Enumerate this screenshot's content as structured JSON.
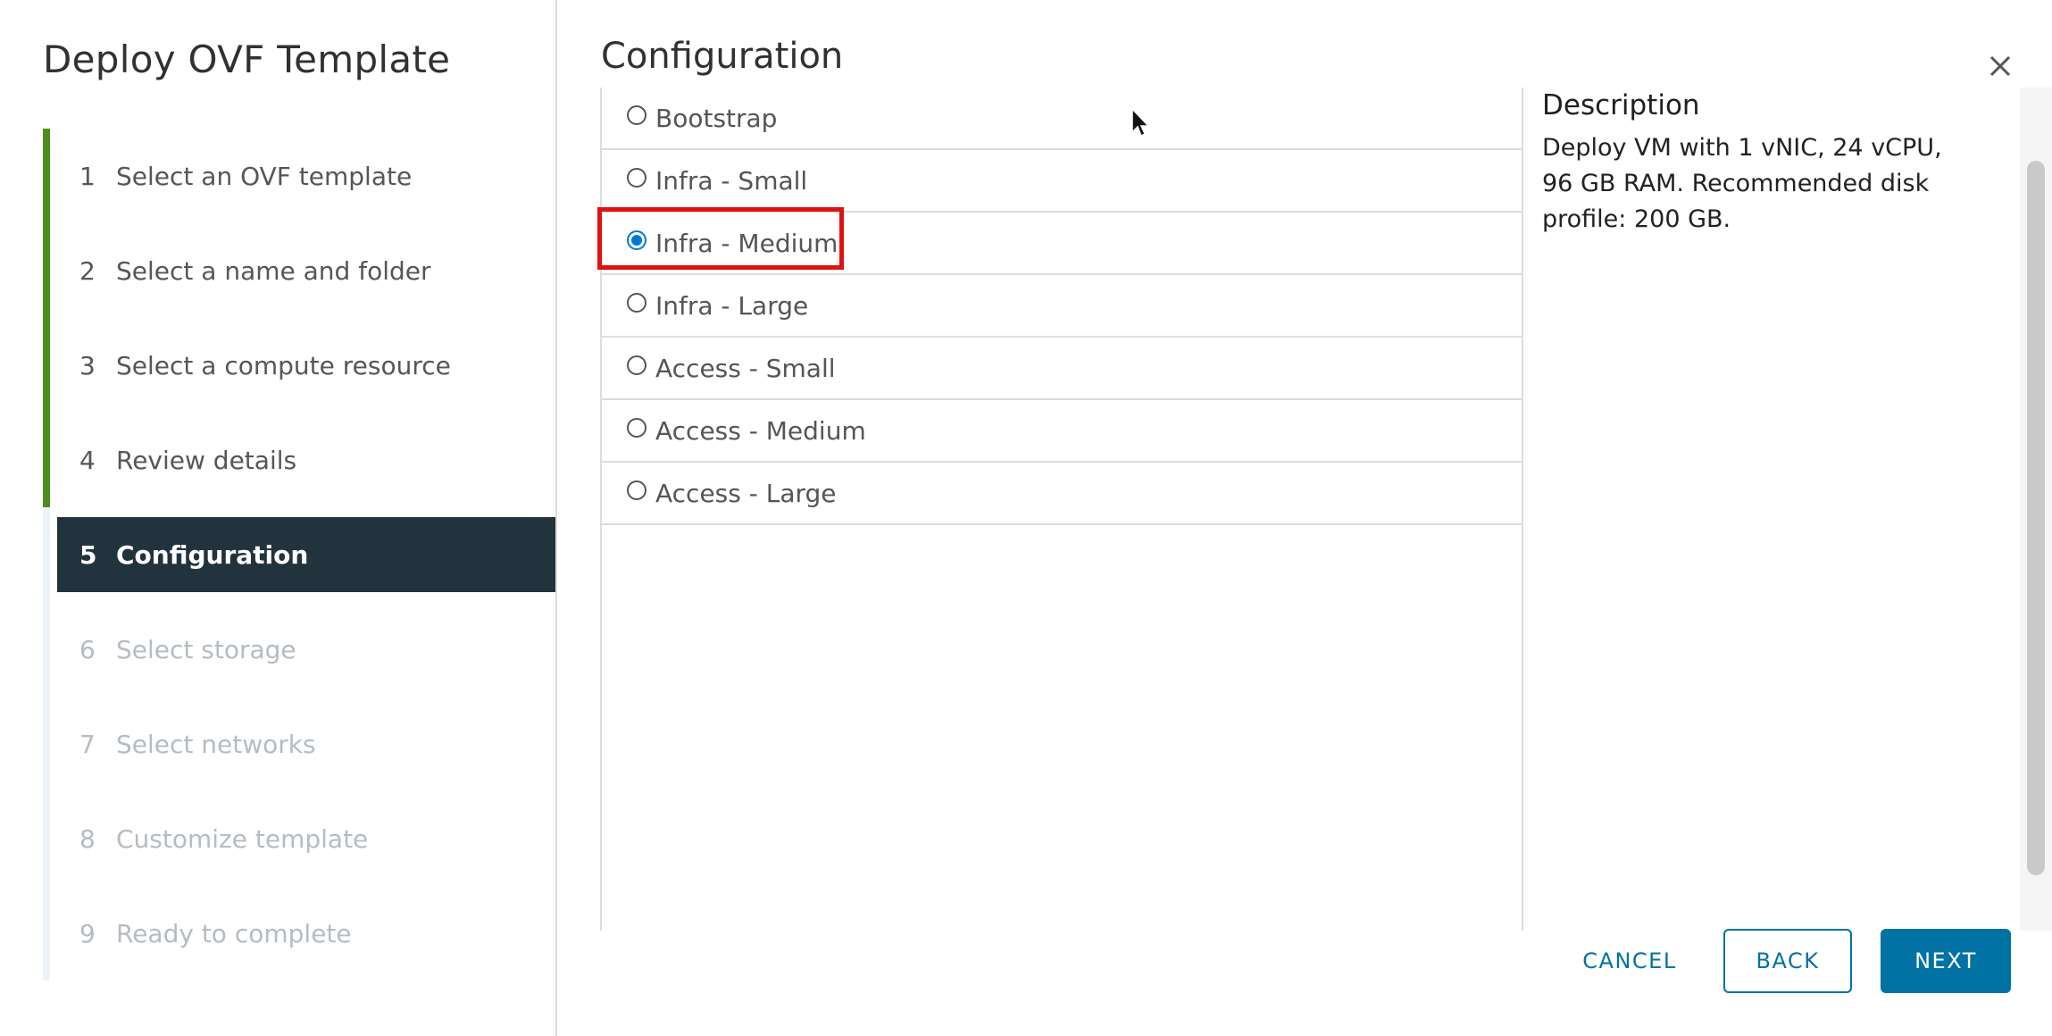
{
  "wizard": {
    "title": "Deploy OVF Template",
    "steps": [
      {
        "number": "1",
        "label": "Select an OVF template",
        "state": "done"
      },
      {
        "number": "2",
        "label": "Select a name and folder",
        "state": "done"
      },
      {
        "number": "3",
        "label": "Select a compute resource",
        "state": "done"
      },
      {
        "number": "4",
        "label": "Review details",
        "state": "done"
      },
      {
        "number": "5",
        "label": "Configuration",
        "state": "active"
      },
      {
        "number": "6",
        "label": "Select storage",
        "state": "pending"
      },
      {
        "number": "7",
        "label": "Select networks",
        "state": "pending"
      },
      {
        "number": "8",
        "label": "Customize template",
        "state": "pending"
      },
      {
        "number": "9",
        "label": "Ready to complete",
        "state": "pending"
      }
    ]
  },
  "content": {
    "title": "Configuration",
    "options": [
      {
        "label": "Bootstrap",
        "selected": false
      },
      {
        "label": "Infra - Small",
        "selected": false
      },
      {
        "label": "Infra - Medium",
        "selected": true
      },
      {
        "label": "Infra - Large",
        "selected": false
      },
      {
        "label": "Access - Small",
        "selected": false
      },
      {
        "label": "Access - Medium",
        "selected": false
      },
      {
        "label": "Access - Large",
        "selected": false
      }
    ],
    "description": {
      "title": "Description",
      "text": "Deploy VM with 1 vNIC, 24 vCPU, 96 GB RAM. Recommended disk profile: 200 GB."
    }
  },
  "footer": {
    "cancel_label": "CANCEL",
    "back_label": "BACK",
    "next_label": "NEXT"
  },
  "icons": {
    "close": "close-icon",
    "cursor": "mouse-pointer-icon"
  },
  "colors": {
    "active_step_bg": "#23333e",
    "done_rail": "#4e8d1a",
    "primary": "#0072a3",
    "radio_selected": "#0079d6",
    "highlight": "#e01111"
  }
}
